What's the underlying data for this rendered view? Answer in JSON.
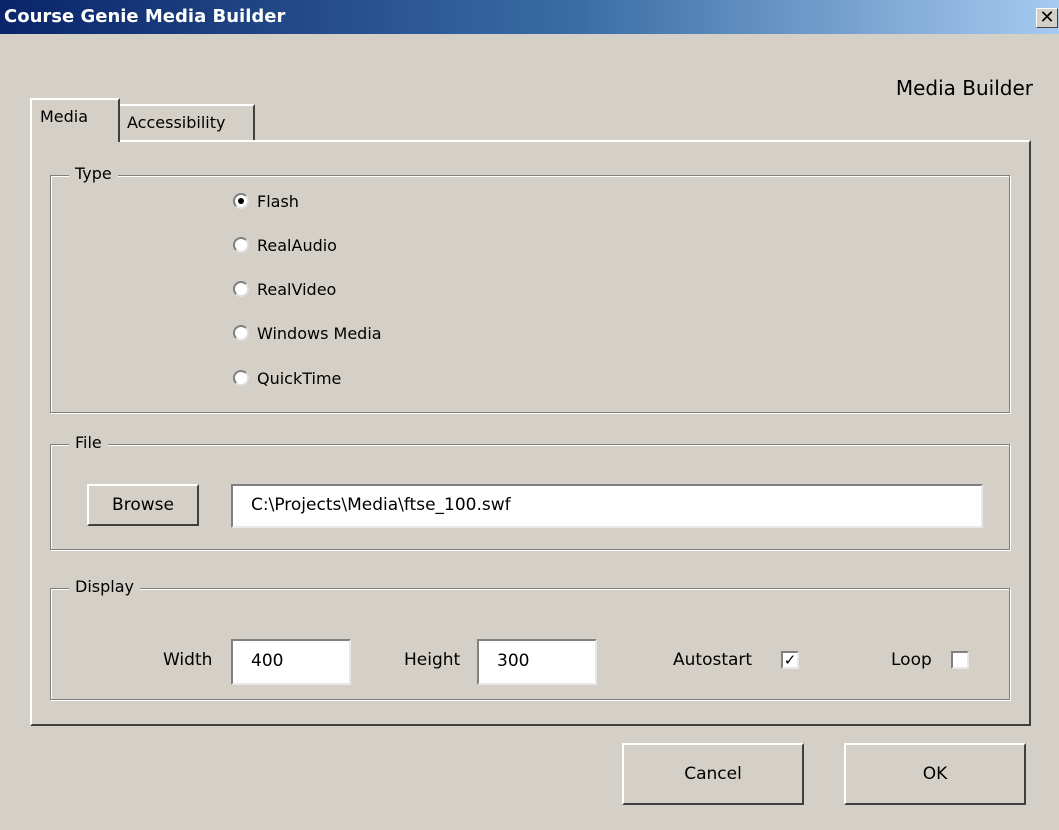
{
  "window": {
    "title": "Course Genie Media Builder",
    "close_glyph": "✕"
  },
  "header": {
    "label": "Media Builder"
  },
  "tabs": [
    {
      "label": "Media"
    },
    {
      "label": "Accessibility"
    }
  ],
  "type_group": {
    "legend": "Type",
    "options": [
      {
        "label": "Flash",
        "selected": true
      },
      {
        "label": "RealAudio",
        "selected": false
      },
      {
        "label": "RealVideo",
        "selected": false
      },
      {
        "label": "Windows Media",
        "selected": false
      },
      {
        "label": "QuickTime",
        "selected": false
      }
    ]
  },
  "file_group": {
    "legend": "File",
    "browse_label": "Browse",
    "path_value": "C:\\Projects\\Media\\ftse_100.swf"
  },
  "display_group": {
    "legend": "Display",
    "width_label": "Width",
    "width_value": "400",
    "height_label": "Height",
    "height_value": "300",
    "autostart_label": "Autostart",
    "autostart_checked": true,
    "loop_label": "Loop",
    "loop_checked": false
  },
  "buttons": {
    "cancel_label": "Cancel",
    "ok_label": "OK"
  }
}
